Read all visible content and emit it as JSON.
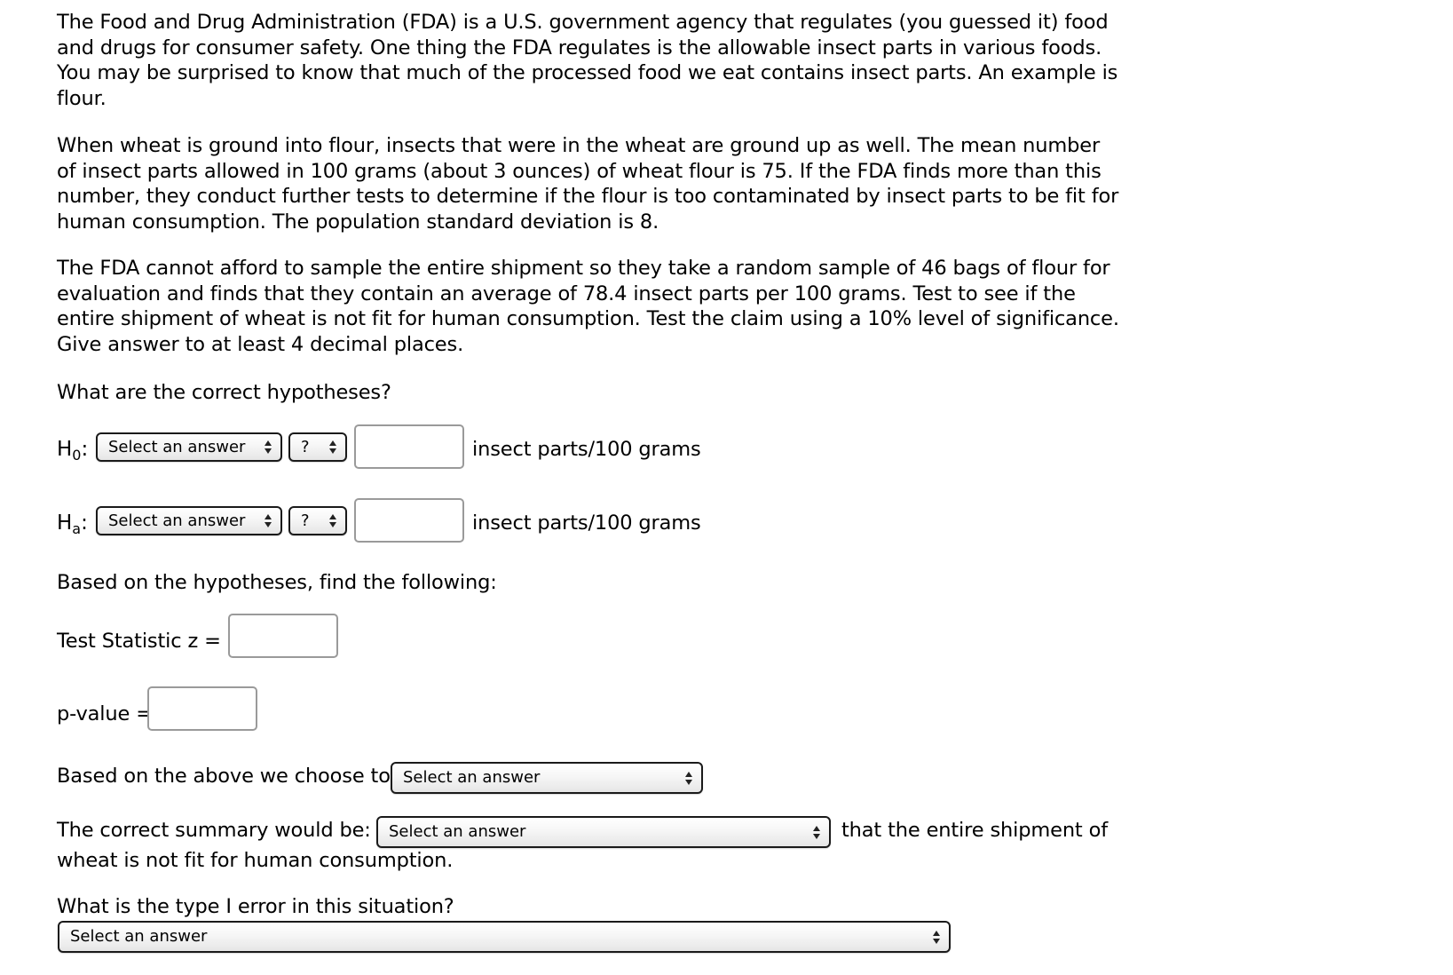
{
  "paragraphs": [
    "The Food and Drug Administration (FDA) is a U.S. government agency that regulates (you guessed it) food and drugs for consumer safety. One thing the FDA regulates is the allowable insect parts in various foods. You may be surprised to know that much of the processed food we eat contains insect parts. An example is flour.",
    "When wheat is ground into flour, insects that were in the wheat are ground up as well. The mean number of insect parts allowed in 100 grams (about 3 ounces) of wheat flour is 75. If the FDA finds more than this number, they conduct further tests to determine if the flour is too contaminated by insect parts to be fit for human consumption. The population standard deviation is 8.",
    "The FDA cannot afford to sample the entire shipment so they take a random sample of 46 bags of flour for evaluation and finds that they contain an average of 78.4 insect parts per 100 grams. Test to see if the entire shipment of wheat is not fit for human consumption. Test the claim using a 10% level of significance. Give answer to at least 4 decimal places."
  ],
  "hypotheses": {
    "question": "What are the correct hypotheses?",
    "h0": {
      "label_main": "H",
      "label_sub": "0",
      "param_select": "Select an answer",
      "operator_select": "?",
      "value": "",
      "unit": "insect parts/100 grams"
    },
    "ha": {
      "label_main": "H",
      "label_sub": "a",
      "param_select": "Select an answer",
      "operator_select": "?",
      "value": "",
      "unit": "insect parts/100 grams"
    }
  },
  "find_following": "Based on the hypotheses, find the following:",
  "test_statistic": {
    "label": "Test Statistic z =",
    "value": ""
  },
  "p_value": {
    "label": "p-value =",
    "value": ""
  },
  "decision": {
    "label": "Based on the above we choose to",
    "select": "Select an answer"
  },
  "summary": {
    "label": "The correct summary would be:",
    "select": "Select an answer",
    "suffix_line1": "that the entire shipment of",
    "suffix_line2": "wheat is not fit for human consumption."
  },
  "type1": {
    "question": "What is the type I error in this situation?",
    "select": "Select an answer"
  }
}
